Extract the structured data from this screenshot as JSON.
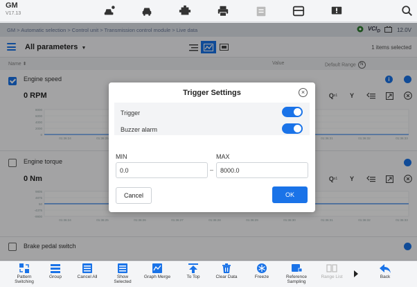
{
  "app": {
    "brand": "GM",
    "version": "V17.13"
  },
  "toolbar_icons": [
    "car-person-icon",
    "car-icon",
    "engine-icon",
    "printer-icon",
    "clipboard-icon",
    "data-log-icon",
    "alert-icon",
    "search-icon"
  ],
  "breadcrumb": "GM > Automatic selection > Control unit > Transmission control module > Live data",
  "status": {
    "vci": "VCI",
    "vci_sub": "D",
    "battery": "12.0V"
  },
  "param_header": {
    "title": "All parameters",
    "items_selected": "1 items selected"
  },
  "columns": {
    "name": "Name",
    "value": "Value",
    "range": "Default Range"
  },
  "rows": [
    {
      "name": "Engine speed",
      "value": "0 RPM",
      "checked": true,
      "y_ticks": [
        "8000",
        "6000",
        "4000",
        "2000",
        "0"
      ],
      "x_ticks": [
        "01:36:24",
        "01:36:25",
        "01:36:26",
        "01:36:27",
        "01:36:28",
        "01:36:29",
        "01:36:30",
        "01:36:31",
        "01:36:32",
        "01:36:33"
      ]
    },
    {
      "name": "Engine torque",
      "value": "0 Nm",
      "checked": false,
      "y_ticks": [
        "9805",
        "4875",
        "50",
        "-4375",
        "-9900"
      ],
      "x_ticks": [
        "01:36:24",
        "01:36:25",
        "01:36:26",
        "01:36:27",
        "01:36:28",
        "01:36:29",
        "01:36:30",
        "01:36:31",
        "01:36:32",
        "01:36:33"
      ]
    },
    {
      "name": "Brake pedal switch",
      "checked": false
    }
  ],
  "row_icon_labels": {
    "compare": "Q",
    "compare_sub": "x1",
    "y_axis": "Y"
  },
  "dialog": {
    "title": "Trigger Settings",
    "trigger_label": "Trigger",
    "trigger_on": true,
    "buzzer_label": "Buzzer alarm",
    "buzzer_on": true,
    "min_label": "MIN",
    "min_value": "0.0",
    "max_label": "MAX",
    "max_value": "8000.0",
    "range_separator": "–",
    "cancel_label": "Cancel",
    "ok_label": "OK"
  },
  "bottom_toolbar": [
    {
      "label": "Pattern\nSwitching",
      "icon": "pattern-switch-icon"
    },
    {
      "label": "Group",
      "icon": "group-icon"
    },
    {
      "label": "Cancel All",
      "icon": "cancel-all-icon"
    },
    {
      "label": "Show\nSelected",
      "icon": "show-selected-icon"
    },
    {
      "label": "Graph Merge",
      "icon": "graph-merge-icon"
    },
    {
      "label": "To Top",
      "icon": "to-top-icon"
    },
    {
      "label": "Clear Data",
      "icon": "trash-icon"
    },
    {
      "label": "Freeze",
      "icon": "snowflake-icon"
    },
    {
      "label": "Reference\nSampling",
      "icon": "reference-sampling-icon"
    },
    {
      "label": "Range List",
      "icon": "range-list-icon",
      "disabled": true
    },
    {
      "label": "",
      "icon": "chevron-right-icon"
    },
    {
      "label": "Back",
      "icon": "back-arrow-icon"
    }
  ],
  "colors": {
    "accent": "#1a73e8",
    "line": "#1a73e8"
  }
}
